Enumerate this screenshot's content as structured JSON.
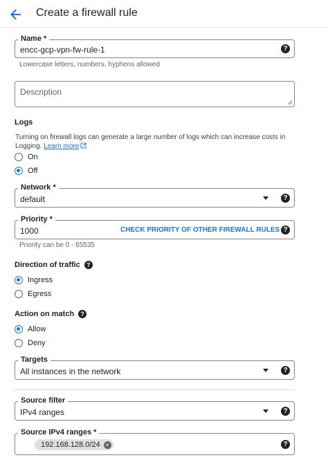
{
  "header": {
    "title": "Create a firewall rule"
  },
  "name_field": {
    "label": "Name *",
    "value": "encc-gcp-vpn-fw-rule-1",
    "hint": "Lowercase letters, numbers, hyphens allowed"
  },
  "description_field": {
    "placeholder": "Description"
  },
  "logs": {
    "heading": "Logs",
    "text": "Turning on firewall logs can generate a large number of logs which can increase costs in Logging.",
    "learn_more": "Learn more",
    "options": [
      {
        "label": "On",
        "checked": false
      },
      {
        "label": "Off",
        "checked": true
      }
    ]
  },
  "network_field": {
    "label": "Network *",
    "value": "default"
  },
  "priority_field": {
    "label": "Priority *",
    "value": "1000",
    "action": "CHECK PRIORITY OF OTHER FIREWALL RULES",
    "hint": "Priority can be 0 - 65535"
  },
  "direction": {
    "heading": "Direction of traffic",
    "options": [
      {
        "label": "Ingress",
        "checked": true
      },
      {
        "label": "Egress",
        "checked": false
      }
    ]
  },
  "action": {
    "heading": "Action on match",
    "options": [
      {
        "label": "Allow",
        "checked": true
      },
      {
        "label": "Deny",
        "checked": false
      }
    ]
  },
  "targets_field": {
    "label": "Targets",
    "value": "All instances in the network"
  },
  "source_filter_field": {
    "label": "Source filter",
    "value": "IPv4 ranges"
  },
  "source_ranges_field": {
    "label": "Source IPv4 ranges *",
    "chips": [
      "192.168.128.0/24"
    ]
  },
  "icons": {
    "back": "arrow-back-icon",
    "help": "help-circle-icon",
    "dropdown": "dropdown-arrow-icon",
    "external": "open-in-new-icon",
    "chip_remove": "cancel-icon"
  },
  "colors": {
    "accent": "#1a73e8",
    "text": "#202124",
    "hint": "#5f6368",
    "border": "#80868b"
  }
}
